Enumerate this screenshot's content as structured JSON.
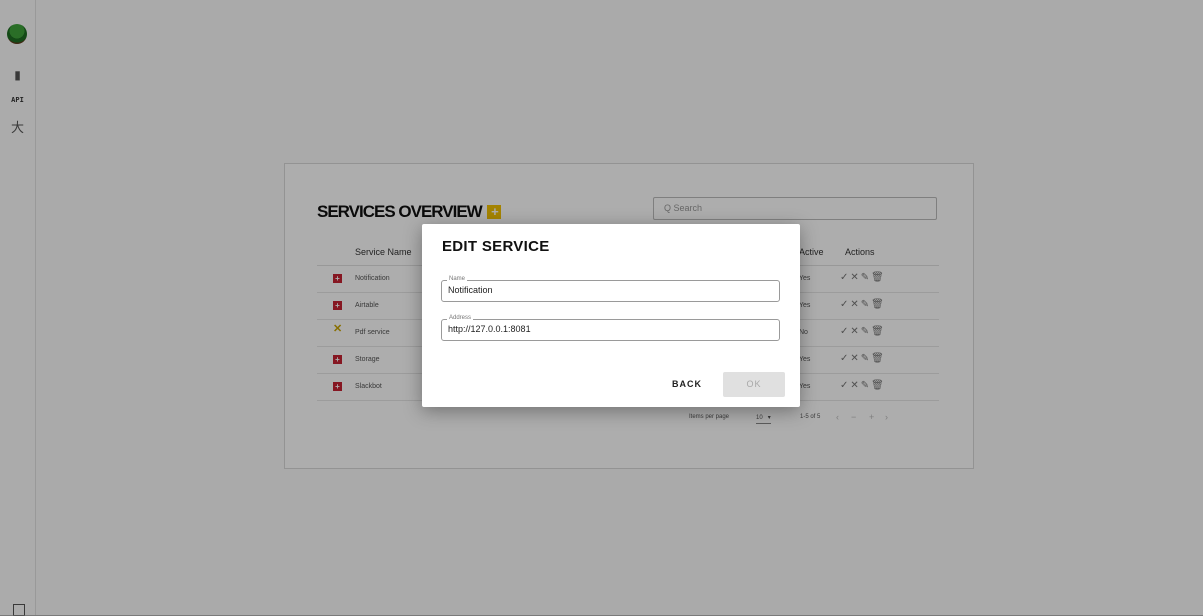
{
  "sidebar": {
    "logo_icon": "tree-logo-icon",
    "items": [
      {
        "name": "document-icon",
        "glyph": "▮"
      },
      {
        "name": "api",
        "label": "API"
      },
      {
        "name": "accessibility-icon",
        "glyph": "大"
      }
    ],
    "bottom_icon": "square-icon"
  },
  "overview": {
    "title": "SERVICES OVERVIEW",
    "add_icon": "+",
    "search_placeholder": "Search",
    "search_icon": "Q",
    "columns": [
      "Service Name",
      "Active",
      "Actions"
    ],
    "rows": [
      {
        "status": "error",
        "status_glyph": "+",
        "name": "Notification",
        "active": "Yes",
        "actions": "✓✕✎🗑"
      },
      {
        "status": "error",
        "status_glyph": "+",
        "name": "Airtable",
        "active": "Yes",
        "actions": "✓✕✎🗑"
      },
      {
        "status": "tool",
        "status_glyph": "✕",
        "name": "Pdf service",
        "active": "No",
        "actions": "✓✕✎🗑"
      },
      {
        "status": "error",
        "status_glyph": "+",
        "name": "Storage",
        "active": "Yes",
        "actions": "✓✕✎🗑"
      },
      {
        "status": "error",
        "status_glyph": "+",
        "name": "Slackbot",
        "active": "Yes",
        "actions": "✓✕✎🗑"
      }
    ],
    "pagination": {
      "items_per_page_label": "Items per page",
      "items_per_page": "10",
      "range": "1-5 of 5",
      "first": "‹",
      "prev": "−",
      "next": "+",
      "last": "›"
    }
  },
  "dialog": {
    "title": "EDIT SERVICE",
    "name_label": "Name",
    "name_value": "Notification",
    "address_label": "Address",
    "address_value": "http://127.0.0.1:8081",
    "back_label": "BACK",
    "ok_label": "OK"
  },
  "colors": {
    "accent_yellow": "#f2c200",
    "error_red": "#c62233",
    "overlay": "rgba(0,0,0,0.32)"
  }
}
